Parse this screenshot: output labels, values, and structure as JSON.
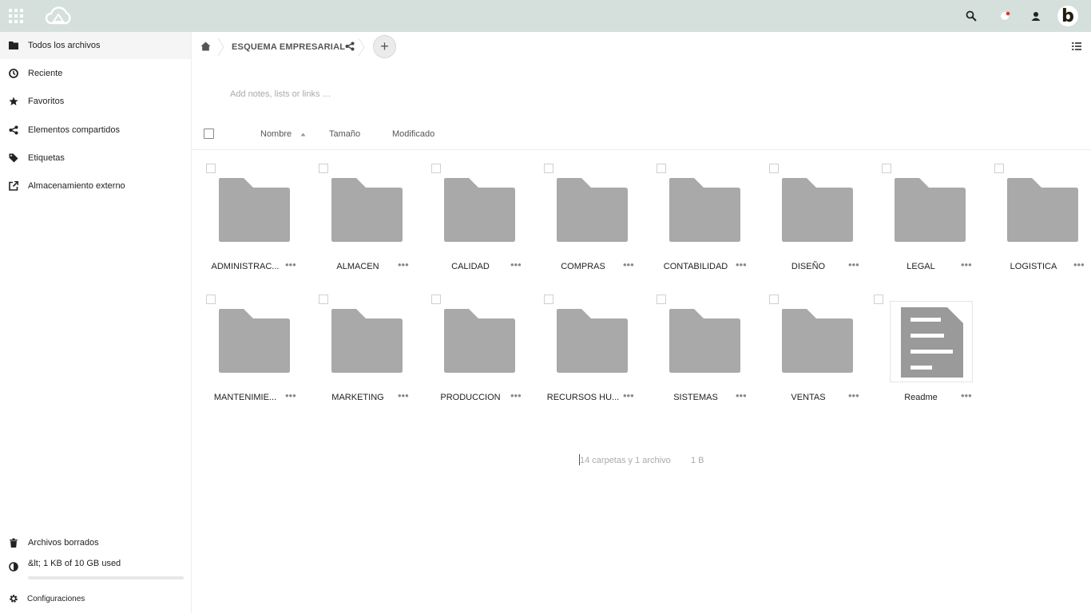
{
  "topbar": {
    "icons": [
      "apps-grid-icon",
      "cloud-logo-icon",
      "search-icon",
      "notifications-icon",
      "contacts-icon"
    ],
    "avatar_letter": "b",
    "bg_color": "#d5dfdc"
  },
  "sidebar": {
    "items": [
      {
        "label": "Todos los archivos",
        "icon": "folder-icon"
      },
      {
        "label": "Reciente",
        "icon": "clock-icon"
      },
      {
        "label": "Favoritos",
        "icon": "star-icon"
      },
      {
        "label": "Elementos compartidos",
        "icon": "share-icon"
      },
      {
        "label": "Etiquetas",
        "icon": "tag-icon"
      },
      {
        "label": "Almacenamiento externo",
        "icon": "external-link-icon"
      }
    ],
    "bottom": {
      "trash": "Archivos borrados",
      "quota": "&lt; 1 KB of 10 GB used",
      "settings": "Configuraciones"
    }
  },
  "breadcrumb": {
    "current": "ESQUEMA EMPRESARIAL",
    "add_label": "+"
  },
  "notes_placeholder": "Add notes, lists or links …",
  "table_header": {
    "name": "Nombre",
    "size": "Tamaño",
    "modified": "Modificado"
  },
  "files": [
    {
      "name": "ADMINISTRAC...",
      "type": "folder"
    },
    {
      "name": "ALMACEN",
      "type": "folder"
    },
    {
      "name": "CALIDAD",
      "type": "folder"
    },
    {
      "name": "COMPRAS",
      "type": "folder"
    },
    {
      "name": "CONTABILIDAD",
      "type": "folder"
    },
    {
      "name": "DISEÑO",
      "type": "folder"
    },
    {
      "name": "LEGAL",
      "type": "folder"
    },
    {
      "name": "LOGISTICA",
      "type": "folder"
    },
    {
      "name": "MANTENIMIE...",
      "type": "folder"
    },
    {
      "name": "MARKETING",
      "type": "folder"
    },
    {
      "name": "PRODUCCION",
      "type": "folder"
    },
    {
      "name": "RECURSOS HU...",
      "type": "folder"
    },
    {
      "name": "SISTEMAS",
      "type": "folder"
    },
    {
      "name": "VENTAS",
      "type": "folder"
    },
    {
      "name": "Readme",
      "type": "file"
    }
  ],
  "more_label": "•••",
  "summary": {
    "counts": "14 carpetas y 1 archivo",
    "size": "1 B"
  }
}
